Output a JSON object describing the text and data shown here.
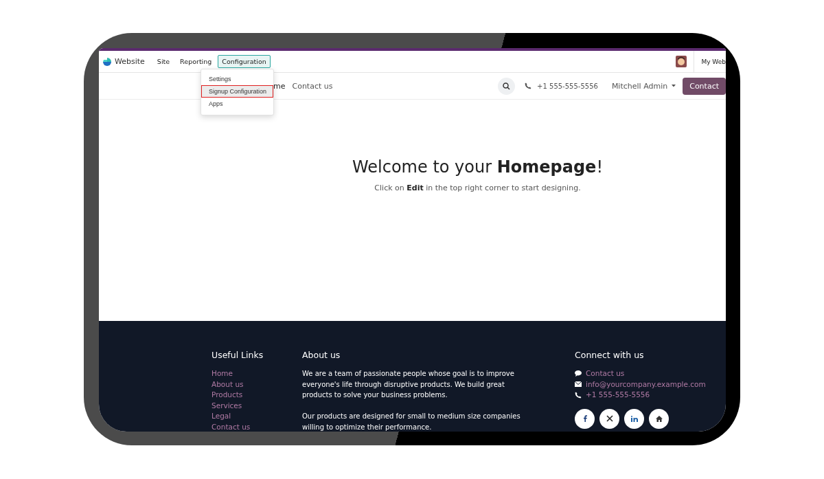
{
  "topbar": {
    "app_name": "Website",
    "menus": [
      {
        "label": "Site",
        "selected": false
      },
      {
        "label": "Reporting",
        "selected": false
      },
      {
        "label": "Configuration",
        "selected": true
      }
    ],
    "website_switcher": "My Web"
  },
  "dropdown": {
    "items": [
      {
        "label": "Settings",
        "selected": false
      },
      {
        "label": "Signup Configuration",
        "selected": true
      },
      {
        "label": "Apps",
        "selected": false
      }
    ]
  },
  "site_header": {
    "nav": [
      "me",
      "Contact us"
    ],
    "phone": "+1 555-555-5556",
    "user": "Mitchell Admin",
    "cta": "Contact"
  },
  "hero": {
    "title": "Welcome to your **Homepage**!",
    "subtitle": "Click on **Edit** in the top right corner to start designing."
  },
  "footer": {
    "useful_links": {
      "heading": "Useful Links",
      "links": [
        "Home",
        "About us",
        "Products",
        "Services",
        "Legal",
        "Contact us"
      ]
    },
    "about": {
      "heading": "About us",
      "paragraphs": [
        "We are a team of passionate people whose goal is to improve everyone's life through disruptive products. We build great products to solve your business problems.",
        "Our products are designed for small to medium size companies willing to optimize their performance."
      ]
    },
    "connect": {
      "heading": "Connect with us",
      "items": [
        {
          "kind": "chat",
          "text": "Contact us"
        },
        {
          "kind": "mail",
          "text": "info@yourcompany.example.com"
        },
        {
          "kind": "phone",
          "text": "+1 555-555-5556"
        }
      ],
      "socials": [
        {
          "kind": "facebook"
        },
        {
          "kind": "x"
        },
        {
          "kind": "linkedin"
        },
        {
          "kind": "home"
        }
      ]
    }
  }
}
